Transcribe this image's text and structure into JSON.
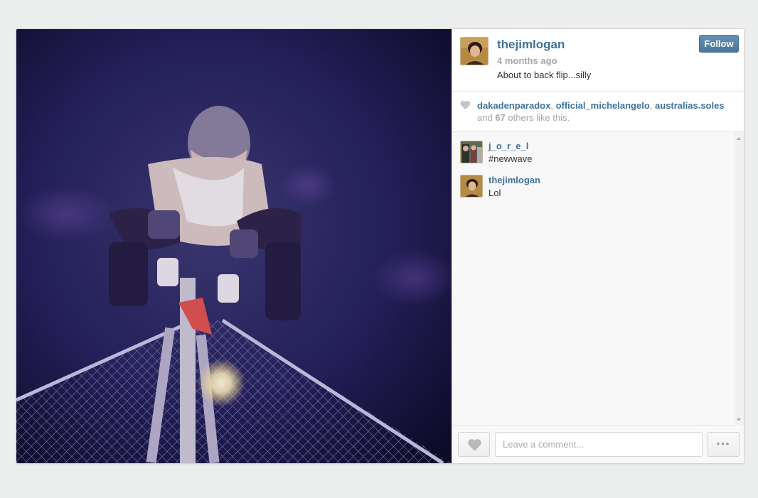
{
  "post": {
    "username": "thejimlogan",
    "time_ago": "4 months ago",
    "caption": "About to back flip...silly",
    "follow_label": "Follow"
  },
  "likes": {
    "likers": [
      "dakadenparadox",
      "official_michelangelo",
      "australias.soles"
    ],
    "separator": ", ",
    "others_prefix": "and ",
    "others_count": "67",
    "others_suffix": " others like this."
  },
  "comments": [
    {
      "user": "j_o_r_e_l",
      "text": "#newwave"
    },
    {
      "user": "thejimlogan",
      "text": "Lol"
    }
  ],
  "footer": {
    "comment_placeholder": "Leave a comment...",
    "more_label": "•••"
  },
  "colors": {
    "username_blue": "#3f729b",
    "follow_button": "#517fa4",
    "muted_gray": "#a5a7aa",
    "page_background": "#eceded"
  },
  "icons": {
    "like_indicator": "heart-icon",
    "like_button": "heart-icon",
    "more_button": "ellipsis-icon"
  }
}
